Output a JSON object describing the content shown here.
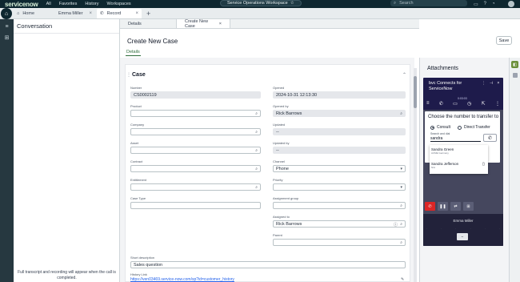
{
  "topnav": {
    "logo": "servicenow",
    "links": [
      "All",
      "Favorites",
      "History",
      "Workspaces"
    ],
    "workspace": "Service Operations Workspace",
    "search_placeholder": "Search"
  },
  "tabs": [
    {
      "label": "Home"
    },
    {
      "label": "Emma Miller"
    },
    {
      "label": "Record"
    }
  ],
  "conversation": {
    "title": "Conversation",
    "footer": "Full transcript and recording will appear when the call is completed."
  },
  "subtabs": [
    {
      "label": "Details"
    },
    {
      "label": "Create New Case"
    }
  ],
  "form": {
    "title": "Create New Case",
    "save_label": "Save",
    "details_tab": "Details",
    "section_title": "Case",
    "fields": {
      "number_label": "Number",
      "number_value": "CS0002119",
      "opened_label": "Opened",
      "opened_value": "2024-10-31 12:13:30",
      "product_label": "Product",
      "opened_by_label": "Opened by",
      "opened_by_value": "Rick Barrows",
      "company_label": "Company",
      "updated_label": "Updated",
      "updated_value": "--",
      "asset_label": "Asset",
      "updated_by_label": "Updated by",
      "updated_by_value": "--",
      "contract_label": "Contract",
      "channel_label": "Channel",
      "channel_value": "Phone",
      "entitlement_label": "Entitlement",
      "priority_label": "Priority",
      "case_type_label": "Case Type",
      "assignment_group_label": "Assignment group",
      "assigned_to_label": "Assigned to",
      "assigned_to_value": "Rick Barrows",
      "parent_label": "Parent",
      "short_desc_label": "Short description",
      "short_desc_value": "Sales question",
      "history_link_label": "History Link",
      "history_link_value": "https://ven03469.service-now.com/sp?id=customer_history"
    }
  },
  "attachments": {
    "title": "Attachments"
  },
  "phone": {
    "title": "bvc Connects for ServiceNow",
    "time": "0:03:03",
    "card_title": "Choose the number to transfer to",
    "consult_label": "Consult",
    "direct_label": "Direct Transfer",
    "search_label": "Search and dial",
    "search_value": "sandra",
    "results": [
      {
        "name": "Sandra Green",
        "sub": "ACME Germany"
      },
      {
        "name": "Sandra Jefferson",
        "sub": "N/A"
      }
    ],
    "caller": "Emma Miller"
  },
  "colors": {
    "topnav_bg": "#0e2730",
    "rail_bg": "#263840",
    "phone_bg": "#1e1b4b",
    "accent_green": "#2f6d3d",
    "end_call_red": "#dc2626"
  }
}
